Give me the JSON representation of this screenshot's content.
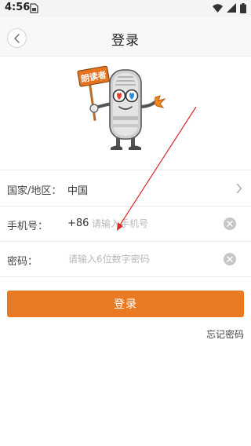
{
  "status_bar": {
    "time": "4:56"
  },
  "nav": {
    "title": "登录"
  },
  "form": {
    "region": {
      "label": "国家/地区：",
      "value": "中国"
    },
    "phone": {
      "label": "手机号：",
      "prefix": "+86",
      "placeholder": "请输入手机号",
      "value": ""
    },
    "password": {
      "label": "密码：",
      "placeholder": "请输入6位数字密码",
      "value": ""
    }
  },
  "actions": {
    "login_label": "登录",
    "forgot_label": "忘记密码"
  },
  "mascot": {
    "sign_text": "朗读者"
  },
  "colors": {
    "accent": "#e87a24",
    "annotation": "#d92b2b"
  },
  "icons": [
    "sim-icon",
    "battery-icon",
    "wifi-icon",
    "signal-icon",
    "back-icon",
    "chevron-right-icon",
    "clear-icon"
  ]
}
